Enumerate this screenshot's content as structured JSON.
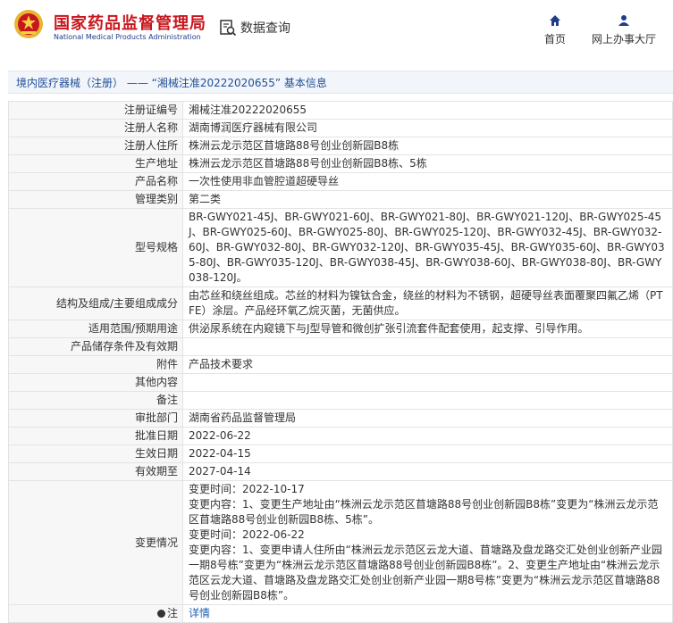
{
  "header": {
    "org_cn": "国家药品监督管理局",
    "org_en": "National Medical Products Administration",
    "data_query": "数据查询",
    "nav": [
      {
        "label": "首页",
        "icon": "home-icon"
      },
      {
        "label": "网上办事大厅",
        "icon": "user-icon"
      }
    ],
    "colors": {
      "brand_red": "#c8161d",
      "brand_blue": "#1f3d8a",
      "link_blue": "#1f60b5"
    }
  },
  "breadcrumb": "境内医疗器械（注册） —— “湘械注准20222020655” 基本信息",
  "rows": [
    {
      "label": "注册证编号",
      "value": "湘械注准20222020655"
    },
    {
      "label": "注册人名称",
      "value": "湖南博润医疗器械有限公司"
    },
    {
      "label": "注册人住所",
      "value": "株洲云龙示范区苜塘路88号创业创新园B8栋"
    },
    {
      "label": "生产地址",
      "value": "株洲云龙示范区苜塘路88号创业创新园B8栋、5栋"
    },
    {
      "label": "产品名称",
      "value": "一次性使用非血管腔道超硬导丝"
    },
    {
      "label": "管理类别",
      "value": "第二类"
    },
    {
      "label": "型号规格",
      "value": "BR-GWY021-45J、BR-GWY021-60J、BR-GWY021-80J、BR-GWY021-120J、BR-GWY025-45J、BR-GWY025-60J、BR-GWY025-80J、BR-GWY025-120J、BR-GWY032-45J、BR-GWY032-60J、BR-GWY032-80J、BR-GWY032-120J、BR-GWY035-45J、BR-GWY035-60J、BR-GWY035-80J、BR-GWY035-120J、BR-GWY038-45J、BR-GWY038-60J、BR-GWY038-80J、BR-GWY038-120J。"
    },
    {
      "label": "结构及组成/主要组成成分",
      "value": "由芯丝和绕丝组成。芯丝的材料为镍钛合金，绕丝的材料为不锈钢，超硬导丝表面覆聚四氟乙烯（PTFE）涂层。产品经环氧乙烷灭菌，无菌供应。"
    },
    {
      "label": "适用范围/预期用途",
      "value": "供泌尿系统在内窥镜下与J型导管和微创扩张引流套件配套使用，起支撑、引导作用。"
    },
    {
      "label": "产品储存条件及有效期",
      "value": ""
    },
    {
      "label": "附件",
      "value": "产品技术要求"
    },
    {
      "label": "其他内容",
      "value": ""
    },
    {
      "label": "备注",
      "value": ""
    },
    {
      "label": "审批部门",
      "value": "湖南省药品监督管理局"
    },
    {
      "label": "批准日期",
      "value": "2022-06-22"
    },
    {
      "label": "生效日期",
      "value": "2022-04-15"
    },
    {
      "label": "有效期至",
      "value": "2027-04-14"
    }
  ],
  "changes": {
    "label": "变更情况",
    "lines": [
      "变更时间：2022-10-17",
      "变更内容：1、变更生产地址由“株洲云龙示范区苜塘路88号创业创新园B8栋”变更为“株洲云龙示范区苜塘路88号创业创新园B8栋、5栋”。",
      "变更时间：2022-06-22",
      "变更内容：1、变更申请人住所由“株洲云龙示范区云龙大道、苜塘路及盘龙路交汇处创业创新产业园一期8号栋”变更为“株洲云龙示范区苜塘路88号创业创新园B8栋”。2、变更生产地址由“株洲云龙示范区云龙大道、苜塘路及盘龙路交汇处创业创新产业园一期8号栋”变更为“株洲云龙示范区苜塘路88号创业创新园B8栋”。"
    ]
  },
  "note": {
    "label": "注",
    "value": "详情"
  }
}
